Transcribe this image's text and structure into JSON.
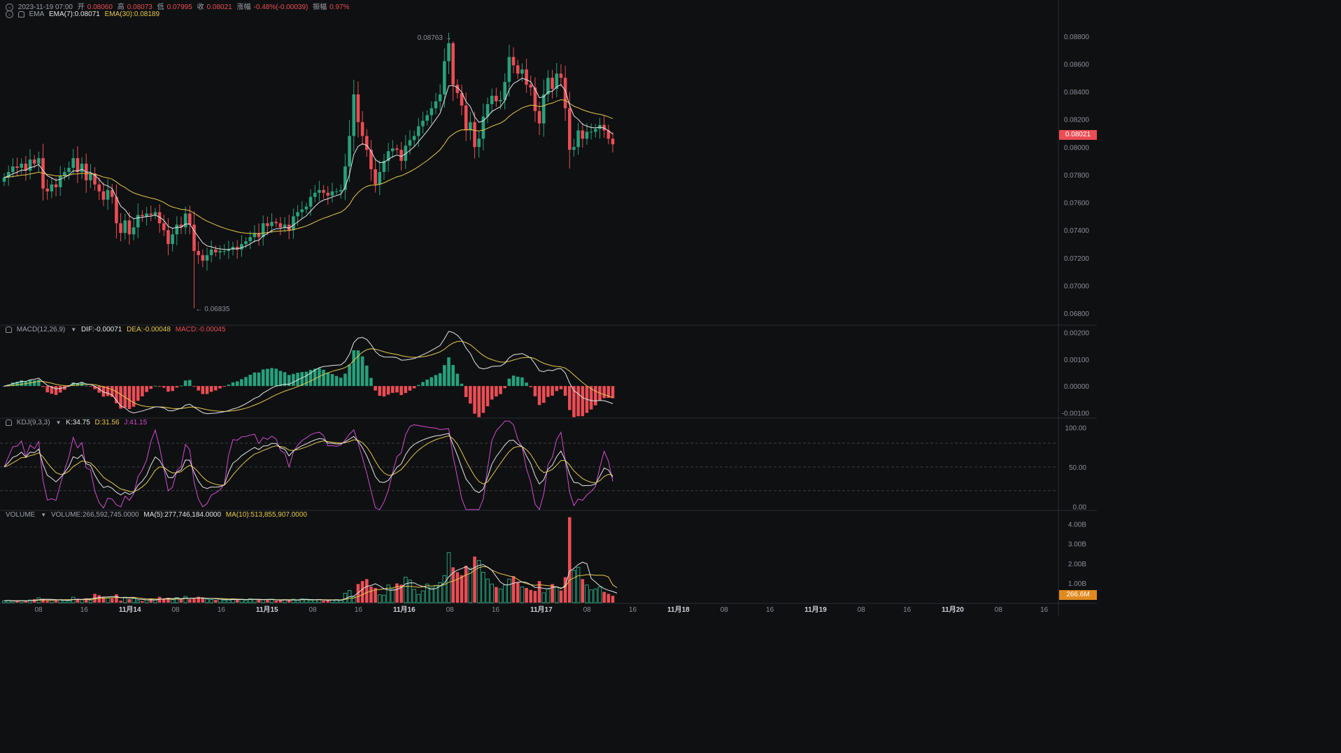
{
  "header": {
    "datetime": "2023-11-19 07:00",
    "open_label": "开",
    "open": "0.08060",
    "high_label": "高",
    "high": "0.08073",
    "low_label": "低",
    "low": "0.07995",
    "close_label": "收",
    "close": "0.08021",
    "change_label": "涨幅",
    "change": "-0.48%(-0.00039)",
    "amplitude_label": "振幅",
    "amplitude": "0.97%",
    "ema_name": "EMA",
    "ema7": "EMA(7):0.08071",
    "ema30": "EMA(30):0.08189"
  },
  "macd": {
    "name": "MACD(12,26,9)",
    "dif": "DIF:-0.00071",
    "dea": "DEA:-0.00048",
    "macd": "MACD:-0.00045"
  },
  "kdj": {
    "name": "KDJ(9,3,3)",
    "k": "K:34.75",
    "d": "D:31.56",
    "j": "J:41.15"
  },
  "volume": {
    "name": "VOLUME",
    "vol": "VOLUME:266,592,745.0000",
    "ma5": "MA(5):277,746,184.0000",
    "ma10": "MA(10):513,855,907.0000"
  },
  "price_axis": [
    "0.08800",
    "0.08600",
    "0.08400",
    "0.08200",
    "0.08000",
    "0.07800",
    "0.07600",
    "0.07400",
    "0.07200",
    "0.07000",
    "0.06800"
  ],
  "macd_axis": [
    "0.00200",
    "0.00100",
    "0.00000",
    "-0.00100"
  ],
  "kdj_axis": [
    "100.00",
    "50.00",
    "0.00"
  ],
  "volume_axis": [
    "4.00B",
    "3.00B",
    "2.00B",
    "1.00B"
  ],
  "current_price_tag": "0.08021",
  "current_volume_tag": "266.6M",
  "max_label": "0.08763",
  "min_label": "0.06835",
  "time_axis": [
    {
      "t": "08",
      "bold": false
    },
    {
      "t": "16",
      "bold": false
    },
    {
      "t": "11月14",
      "bold": true
    },
    {
      "t": "08",
      "bold": false
    },
    {
      "t": "16",
      "bold": false
    },
    {
      "t": "11月15",
      "bold": true
    },
    {
      "t": "08",
      "bold": false
    },
    {
      "t": "16",
      "bold": false
    },
    {
      "t": "11月16",
      "bold": true
    },
    {
      "t": "08",
      "bold": false
    },
    {
      "t": "16",
      "bold": false
    },
    {
      "t": "11月17",
      "bold": true
    },
    {
      "t": "08",
      "bold": false
    },
    {
      "t": "16",
      "bold": false
    },
    {
      "t": "11月18",
      "bold": true
    },
    {
      "t": "08",
      "bold": false
    },
    {
      "t": "16",
      "bold": false
    },
    {
      "t": "11月19",
      "bold": true
    },
    {
      "t": "08",
      "bold": false
    },
    {
      "t": "16",
      "bold": false
    },
    {
      "t": "11月20",
      "bold": true
    },
    {
      "t": "08",
      "bold": false
    },
    {
      "t": "16",
      "bold": false
    }
  ],
  "colors": {
    "up": "#26a17b",
    "down": "#ea4d54",
    "ema7": "#e6e6e6",
    "ema30": "#e6c84a",
    "k": "#e6e6e6",
    "d": "#e6c84a",
    "j": "#d34bd0",
    "grid": "#1f2226",
    "volTag": "#e08a1e"
  },
  "chart_data": {
    "type": "candlestick",
    "interval_hours": 2,
    "price_range": [
      0.0674,
      0.0891
    ],
    "price_closes": [
      0.0778,
      0.0782,
      0.0786,
      0.0785,
      0.0788,
      0.0783,
      0.0791,
      0.0788,
      0.0792,
      0.077,
      0.0768,
      0.0773,
      0.0771,
      0.0779,
      0.0782,
      0.0785,
      0.0792,
      0.0782,
      0.0788,
      0.0776,
      0.0781,
      0.0773,
      0.0768,
      0.0762,
      0.0769,
      0.0764,
      0.0745,
      0.0738,
      0.0747,
      0.0737,
      0.0742,
      0.0751,
      0.075,
      0.0752,
      0.0751,
      0.0753,
      0.0745,
      0.074,
      0.073,
      0.0737,
      0.0744,
      0.0742,
      0.0752,
      0.0744,
      0.0725,
      0.0722,
      0.0718,
      0.0722,
      0.0726,
      0.0724,
      0.0725,
      0.0725,
      0.0726,
      0.0728,
      0.0726,
      0.073,
      0.0732,
      0.0735,
      0.0738,
      0.0735,
      0.0745,
      0.0743,
      0.0746,
      0.0745,
      0.0742,
      0.0744,
      0.074,
      0.075,
      0.0753,
      0.0755,
      0.0757,
      0.0764,
      0.0767,
      0.0769,
      0.0767,
      0.0765,
      0.0768,
      0.0768,
      0.0769,
      0.0786,
      0.0808,
      0.0838,
      0.0818,
      0.0808,
      0.0798,
      0.0784,
      0.0773,
      0.0782,
      0.079,
      0.0797,
      0.0799,
      0.0798,
      0.079,
      0.0801,
      0.0805,
      0.0808,
      0.0815,
      0.0819,
      0.0823,
      0.0828,
      0.0833,
      0.0838,
      0.0862,
      0.0875,
      0.0845,
      0.0839,
      0.083,
      0.0812,
      0.0818,
      0.08,
      0.0806,
      0.0822,
      0.0831,
      0.0837,
      0.0833,
      0.0834,
      0.0847,
      0.0865,
      0.0859,
      0.0853,
      0.0856,
      0.0845,
      0.0843,
      0.0826,
      0.0817,
      0.0838,
      0.085,
      0.0842,
      0.0853,
      0.085,
      0.0828,
      0.0798,
      0.08,
      0.0812,
      0.0806,
      0.0811,
      0.0811,
      0.0813,
      0.0816,
      0.0812,
      0.0806,
      0.0802
    ],
    "ema7_end": 0.08071,
    "ema30_end": 0.08189,
    "high": 0.08763,
    "low": 0.06835,
    "macd_range": [
      -0.0012,
      0.0022
    ],
    "kdj_range": [
      -5,
      110
    ],
    "volume_max_billions": 4.2,
    "volume_billions": [
      0.1,
      0.12,
      0.08,
      0.1,
      0.1,
      0.09,
      0.14,
      0.18,
      0.25,
      0.2,
      0.1,
      0.12,
      0.12,
      0.16,
      0.12,
      0.1,
      0.28,
      0.2,
      0.15,
      0.22,
      0.12,
      0.45,
      0.38,
      0.28,
      0.24,
      0.22,
      0.42,
      0.1,
      0.28,
      0.18,
      0.22,
      0.1,
      0.08,
      0.14,
      0.2,
      0.15,
      0.3,
      0.18,
      0.25,
      0.15,
      0.26,
      0.2,
      0.32,
      0.18,
      0.2,
      0.3,
      0.22,
      0.18,
      0.16,
      0.14,
      0.2,
      0.12,
      0.14,
      0.2,
      0.16,
      0.18,
      0.12,
      0.2,
      0.18,
      0.16,
      0.14,
      0.14,
      0.18,
      0.1,
      0.12,
      0.16,
      0.14,
      0.18,
      0.12,
      0.2,
      0.18,
      0.12,
      0.14,
      0.16,
      0.1,
      0.12,
      0.14,
      0.16,
      0.12,
      0.48,
      0.62,
      0.3,
      0.95,
      1.1,
      1.2,
      0.82,
      0.75,
      0.4,
      0.38,
      0.9,
      0.7,
      0.98,
      0.92,
      1.3,
      1.15,
      0.68,
      0.42,
      0.6,
      0.95,
      0.75,
      0.88,
      1.02,
      1.38,
      2.55,
      1.8,
      1.55,
      1.4,
      1.88,
      1.75,
      2.35,
      2.15,
      1.55,
      1.2,
      0.95,
      0.8,
      0.7,
      0.9,
      1.2,
      1.35,
      1.05,
      0.8,
      0.75,
      0.65,
      0.6,
      1.1,
      0.5,
      0.7,
      0.95,
      0.8,
      0.62,
      1.3,
      4.35,
      1.65,
      1.8,
      1.2,
      0.9,
      0.65,
      0.7,
      0.8,
      0.55,
      0.45,
      0.35,
      0.27
    ]
  }
}
